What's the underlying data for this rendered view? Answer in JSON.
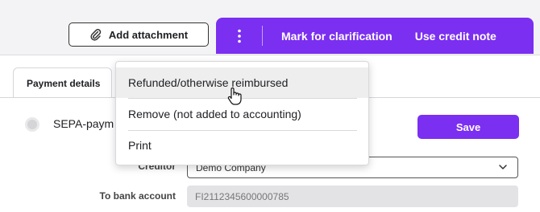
{
  "toolbar": {
    "attach_label": "Add attachment",
    "mark_label": "Mark for clarification",
    "credit_note_label": "Use credit note",
    "more_icon": "more-vertical-icon",
    "attach_icon": "paperclip-icon",
    "accent_color": "#7b2ff0"
  },
  "tabs": [
    {
      "label": "Payment details"
    }
  ],
  "payment": {
    "method_label": "SEPA-paym",
    "save_label": "Save",
    "creditor_label": "Creditor",
    "creditor_value": "Demo Company",
    "bank_label": "To bank account",
    "bank_value": "FI2112345600000785"
  },
  "menu": {
    "items": [
      {
        "label": "Refunded/otherwise reimbursed"
      },
      {
        "label": "Remove (not added to accounting)"
      },
      {
        "label": "Print"
      }
    ]
  }
}
